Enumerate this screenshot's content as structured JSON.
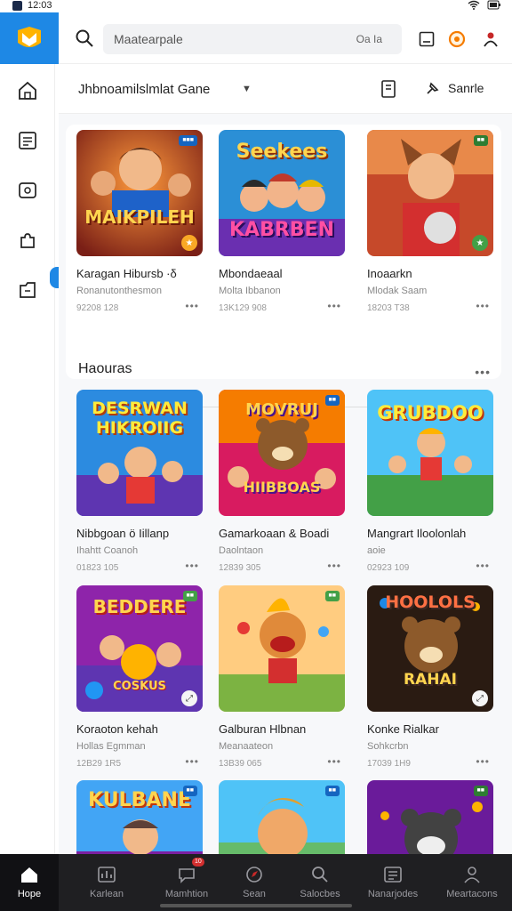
{
  "status_bar": {
    "time": "12:03"
  },
  "header": {
    "search_placeholder": "Maatearpale",
    "search_hint": "Oa Ia"
  },
  "section1": {
    "title": "Jhbnoamilslmlat Gane",
    "sort_label": "Sanrle",
    "cards": [
      {
        "art_line1": "MAIKPILEH",
        "title": "Karagan Hibursb ·δ",
        "subtitle": "Ronanutonthesmon",
        "meta": "92208 128"
      },
      {
        "art_line1": "Seekees",
        "art_line2": "KABRBEN",
        "title": "Mbondaeaal",
        "subtitle": "Molta Ibbanon",
        "meta": "13K129 908"
      },
      {
        "art_line1": "",
        "title": "Inoaarkn",
        "subtitle": "Mlodak Saam",
        "meta": "18203 T38"
      }
    ]
  },
  "section2": {
    "title": "Haouras",
    "cards": [
      {
        "art_line1": "DESRWAN",
        "art_line2": "HIKROIIG",
        "title": "Nibbgoan ö Iillanp",
        "subtitle": "Ihahtt Coanoh",
        "meta": "01823 105"
      },
      {
        "art_line1": "MOVRUJ",
        "art_line2": "HIIBBOAS",
        "title": "Gamarkoaan & Boadi",
        "subtitle": "Daolntaon",
        "meta": "12839 305"
      },
      {
        "art_line1": "GRUBDOO",
        "title": "Mangrart Iloolonlah",
        "subtitle": "aoie",
        "meta": "02923 109"
      },
      {
        "art_line1": "BEDDERE",
        "art_line2": "COSKUS",
        "title": "Koraoton kehah",
        "subtitle": "Hollas Egmman",
        "meta": "12B29 1R5"
      },
      {
        "art_line1": "",
        "title": "Galburan Hlbnan",
        "subtitle": "Meanaateon",
        "meta": "13B39 065"
      },
      {
        "art_line1": "HOOLOLS",
        "art_line2": "RAHAI",
        "title": "Konke Rialkar",
        "subtitle": "Sohkcrbn",
        "meta": "17039 1H9"
      },
      {
        "art_line1": "KULBANE",
        "title": "",
        "subtitle": "",
        "meta": ""
      },
      {
        "art_line1": "",
        "title": "",
        "subtitle": "",
        "meta": ""
      },
      {
        "art_line1": "",
        "title": "",
        "subtitle": "",
        "meta": ""
      }
    ]
  },
  "bottom_nav": {
    "items": [
      {
        "label": "Hope",
        "icon": "home-icon"
      },
      {
        "label": "Karlean",
        "icon": "chart-icon"
      },
      {
        "label": "Mamhtion",
        "icon": "chat-icon",
        "badge": "10"
      },
      {
        "label": "Sean",
        "icon": "compass-icon"
      },
      {
        "label": "Salocbes",
        "icon": "search-icon"
      },
      {
        "label": "Nanarjodes",
        "icon": "list-icon"
      },
      {
        "label": "Meartacons",
        "icon": "profile-icon"
      }
    ]
  },
  "colors": {
    "accent": "#1e88e5",
    "nav_bg": "#1f1f22"
  }
}
